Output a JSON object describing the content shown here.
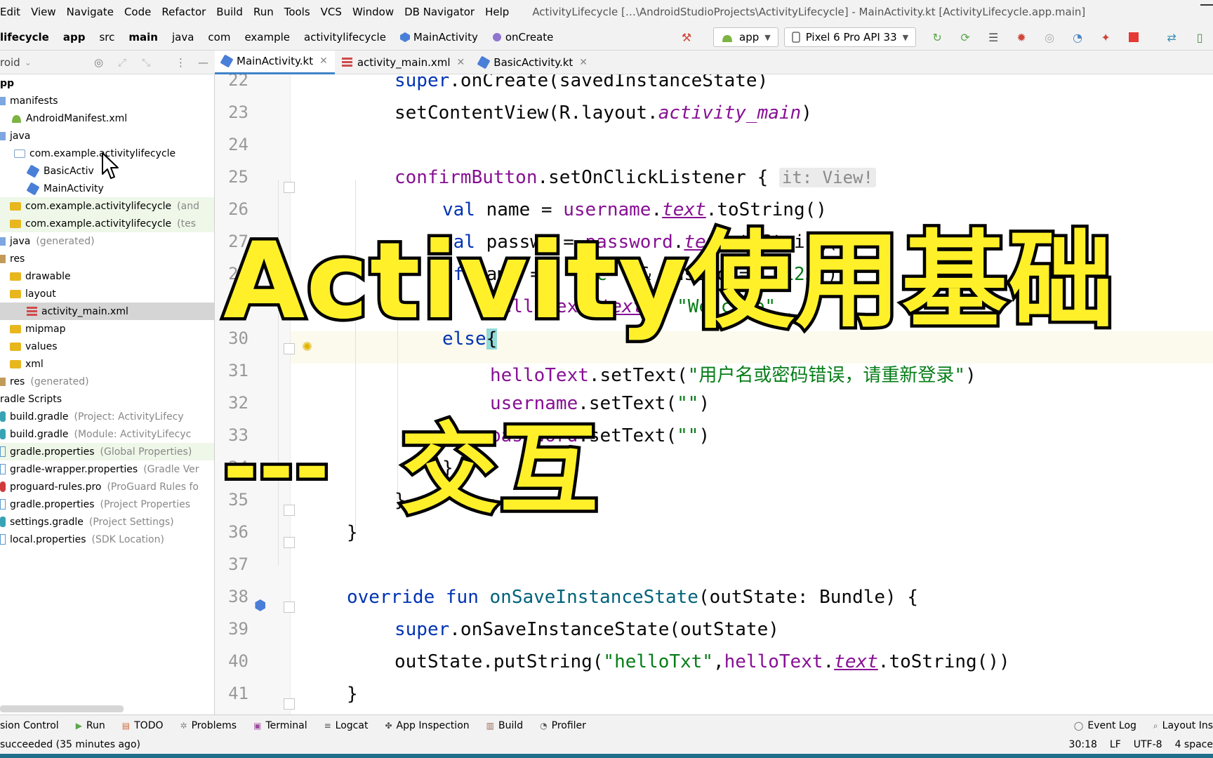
{
  "menu": {
    "items": [
      "Edit",
      "View",
      "Navigate",
      "Code",
      "Refactor",
      "Build",
      "Run",
      "Tools",
      "VCS",
      "Window",
      "DB Navigator",
      "Help"
    ],
    "window_title": "ActivityLifecycle […\\AndroidStudioProjects\\ActivityLifecycle] - MainActivity.kt [ActivityLifecycle.app.main]"
  },
  "breadcrumbs": [
    "lifecycle",
    "app",
    "src",
    "main",
    "java",
    "com",
    "example",
    "activitylifecycle",
    "MainActivity",
    "onCreate"
  ],
  "run_config": {
    "module": "app",
    "device": "Pixel 6 Pro API 33"
  },
  "project_panel": {
    "view_label": "roid",
    "tree": [
      {
        "label": "pp",
        "hint": "",
        "icon": "module-icon"
      },
      {
        "label": "manifests",
        "hint": "",
        "icon": "folder-blue-icon"
      },
      {
        "label": "AndroidManifest.xml",
        "hint": "",
        "icon": "android-icon"
      },
      {
        "label": "java",
        "hint": "",
        "icon": "folder-blue-icon"
      },
      {
        "label": "com.example.activitylifecycle",
        "hint": "",
        "icon": "package-icon"
      },
      {
        "label": "BasicActiv",
        "hint": "",
        "icon": "kotlin-class-icon"
      },
      {
        "label": "MainActivity",
        "hint": "",
        "icon": "kotlin-class-icon"
      },
      {
        "label": "com.example.activitylifecycle",
        "hint": "(and",
        "icon": "package-icon"
      },
      {
        "label": "com.example.activitylifecycle",
        "hint": "(tes",
        "icon": "package-icon"
      },
      {
        "label": "java",
        "hint": "(generated)",
        "icon": "folder-gen-icon"
      },
      {
        "label": "res",
        "hint": "",
        "icon": "folder-res-icon"
      },
      {
        "label": "drawable",
        "hint": "",
        "icon": "folder-icon"
      },
      {
        "label": "layout",
        "hint": "",
        "icon": "folder-icon"
      },
      {
        "label": "activity_main.xml",
        "hint": "",
        "icon": "layout-xml-icon"
      },
      {
        "label": "mipmap",
        "hint": "",
        "icon": "folder-icon"
      },
      {
        "label": "values",
        "hint": "",
        "icon": "folder-icon"
      },
      {
        "label": "xml",
        "hint": "",
        "icon": "folder-icon"
      },
      {
        "label": "res",
        "hint": "(generated)",
        "icon": "folder-res-icon"
      },
      {
        "label": "radle Scripts",
        "hint": "",
        "icon": ""
      },
      {
        "label": "build.gradle",
        "hint": "(Project: ActivityLifecy",
        "icon": "gradle-icon"
      },
      {
        "label": "build.gradle",
        "hint": "(Module: ActivityLifecyc",
        "icon": "gradle-icon"
      },
      {
        "label": "gradle.properties",
        "hint": "(Global Properties)",
        "icon": "properties-icon"
      },
      {
        "label": "gradle-wrapper.properties",
        "hint": "(Gradle Ver",
        "icon": "properties-icon"
      },
      {
        "label": "proguard-rules.pro",
        "hint": "(ProGuard Rules fo",
        "icon": "proguard-icon"
      },
      {
        "label": "gradle.properties",
        "hint": "(Project Properties",
        "icon": "properties-icon"
      },
      {
        "label": "settings.gradle",
        "hint": "(Project Settings)",
        "icon": "gradle-icon"
      },
      {
        "label": "local.properties",
        "hint": "(SDK Location)",
        "icon": "properties-icon"
      }
    ]
  },
  "tabs": [
    {
      "label": "MainActivity.kt",
      "active": true
    },
    {
      "label": "activity_main.xml",
      "active": false
    },
    {
      "label": "BasicActivity.kt",
      "active": false
    }
  ],
  "editor": {
    "line_numbers": [
      "22",
      "23",
      "24",
      "25",
      "26",
      "27",
      "28",
      "29",
      "30",
      "31",
      "32",
      "33",
      "34",
      "35",
      "36",
      "37",
      "38",
      "39",
      "40",
      "41"
    ],
    "current_line": "30",
    "lines": {
      "l22": [
        "super",
        ".onCreate(savedInstanceState)"
      ],
      "l23": [
        "setContentView(R.layout.",
        "activity_main",
        ")"
      ],
      "l25": [
        "confirmButton",
        ".setOnClickListener { ",
        "it: View!"
      ],
      "l26": [
        "val",
        " name = ",
        "username",
        ".",
        "text",
        ".toString()"
      ],
      "l27": [
        "val",
        " passwd = ",
        "password",
        ".",
        "text",
        ".toString()"
      ],
      "l28": [
        "if",
        "(name == ",
        "\"abc\"",
        " && passwd == ",
        "\"123\"",
        ")"
      ],
      "l29": [
        "helloText",
        ".",
        "text",
        " = ",
        "\"Welcome\""
      ],
      "l30": [
        "else",
        "{"
      ],
      "l31": [
        "helloText",
        ".setText(",
        "\"用户名或密码错误，请重新登录\"",
        ")"
      ],
      "l32": [
        "username",
        ".setText(",
        "\"\"",
        ")"
      ],
      "l33": [
        "password",
        ".setText(",
        "\"\"",
        ")"
      ],
      "l34": [
        "}"
      ],
      "l35": [
        "}"
      ],
      "l36": [
        "}"
      ],
      "l38": [
        "override",
        " ",
        "fun",
        " ",
        "onSaveInstanceState",
        "(outState: Bundle) {"
      ],
      "l39": [
        "super",
        ".onSaveInstanceState(outState)"
      ],
      "l40": [
        "outState.putString(",
        "\"helloTxt\"",
        ",",
        "helloText",
        ".",
        "text",
        ".toString())"
      ],
      "l41": [
        "}"
      ]
    }
  },
  "overlay": {
    "title": "Activity使用基础",
    "dash": "---",
    "subtitle": "交互"
  },
  "bottom_tools": {
    "left": [
      "sion Control",
      "Run",
      "TODO",
      "Problems",
      "Terminal",
      "Logcat",
      "App Inspection",
      "Build",
      "Profiler"
    ],
    "right": [
      "Event Log",
      "Layout Ins"
    ]
  },
  "status": {
    "message": "succeeded (35 minutes ago)",
    "position": "30:18",
    "line_sep": "LF",
    "encoding": "UTF-8",
    "indent": "4 space"
  },
  "colors": {
    "keyword": "#0033b3",
    "function": "#00627a",
    "property": "#871094",
    "string": "#067d17",
    "overlay_fill": "#fff02a",
    "overlay_stroke": "#000000"
  }
}
